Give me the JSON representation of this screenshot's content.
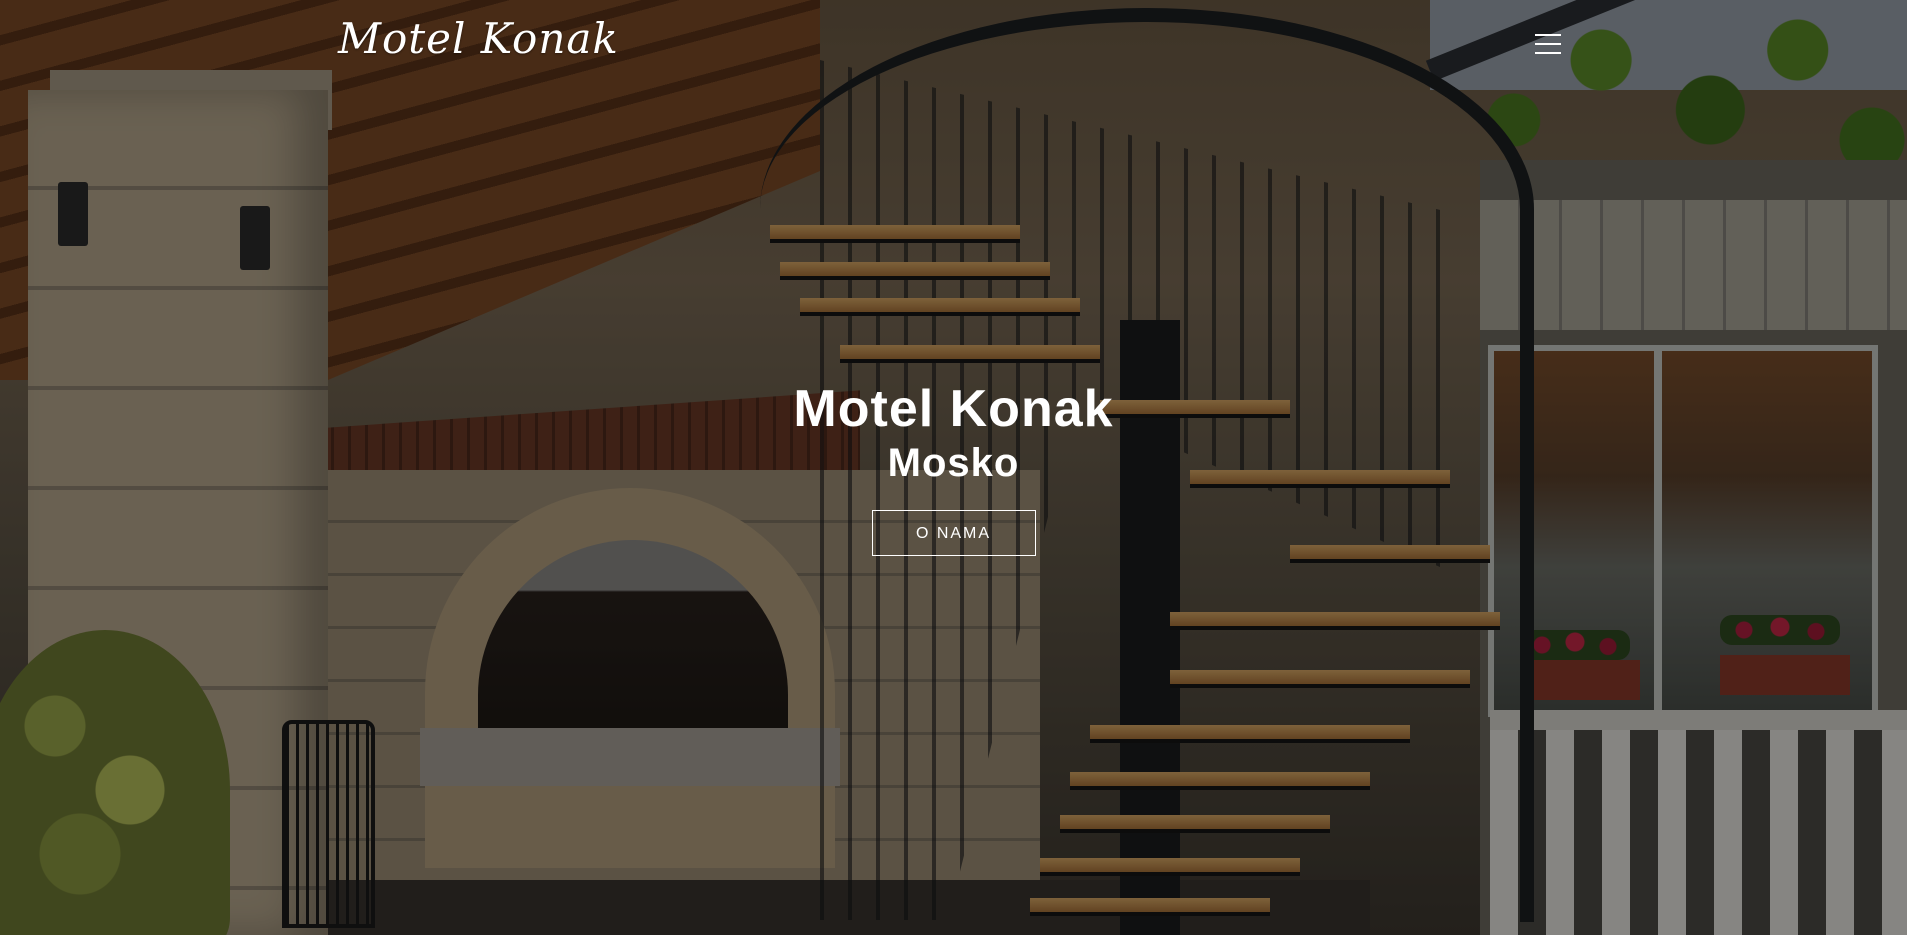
{
  "nav": {
    "brand": "Motel Konak",
    "menu_icon": "hamburger-menu-icon"
  },
  "hero": {
    "title": "Motel Konak",
    "subtitle": "Mosko",
    "cta_label": "O NAMA"
  },
  "colors": {
    "text": "#ffffff",
    "overlay": "rgba(0,0,0,0.42)"
  }
}
